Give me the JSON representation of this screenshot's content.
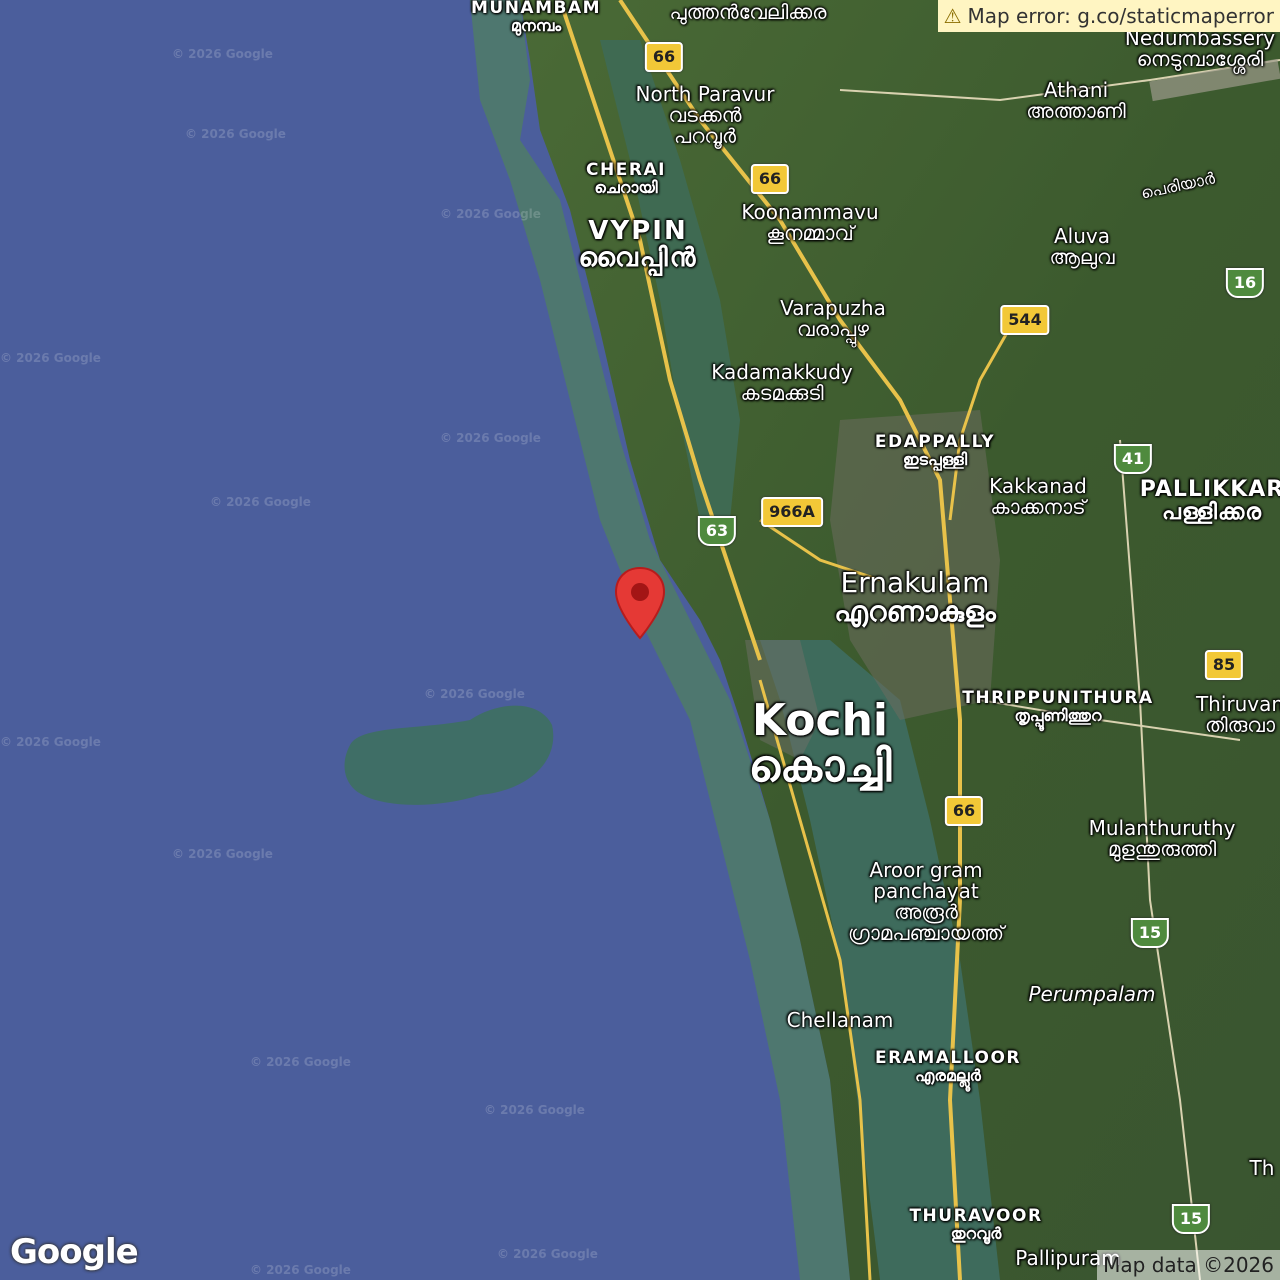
{
  "map": {
    "colors": {
      "sea": "#4b5e9c",
      "land": "#3e5a2e",
      "coastal": "#4f7a6a",
      "road": "#e8c24a"
    },
    "labels": {
      "munambam": {
        "en": "MUNAMBAM",
        "ml": "മുനമ്പം"
      },
      "puthenvelikkara": {
        "ml": "പുത്തൻവേലിക്കര"
      },
      "nedumbassery": {
        "en": "Nedumbassery",
        "ml": "നെടുമ്പാശ്ശേരി"
      },
      "north_paravur": {
        "en": "North Paravur",
        "ml1": "വടക്കൻ",
        "ml2": "പറവൂർ"
      },
      "athani": {
        "en": "Athani",
        "ml": "അത്താണി"
      },
      "cherai": {
        "en": "CHERAI",
        "ml": "ചെറായി"
      },
      "periyar": {
        "ml": "പെരിയാർ"
      },
      "vypin": {
        "en": "VYPIN",
        "ml": "വൈപ്പിൻ"
      },
      "koonammavu": {
        "en": "Koonammavu",
        "ml": "കൂനമ്മാവ്"
      },
      "aluva": {
        "en": "Aluva",
        "ml": "ആലുവ"
      },
      "varapuzha": {
        "en": "Varapuzha",
        "ml": "വരാപ്പുഴ"
      },
      "kadamakkudy": {
        "en": "Kadamakkudy",
        "ml": "കടമക്കുടി"
      },
      "edappally": {
        "en": "EDAPPALLY",
        "ml": "ഇടപ്പള്ളി"
      },
      "kakkanad": {
        "en": "Kakkanad",
        "ml": "കാക്കനാട്"
      },
      "pallikkara": {
        "en": "PALLIKKAR",
        "ml": "പള്ളിക്കര"
      },
      "ernakulam": {
        "en": "Ernakulam",
        "ml": "എറണാകുളം"
      },
      "thrippunithura": {
        "en": "THRIPPUNITHURA",
        "ml": "തൃപ്പൂണിത്തുറ"
      },
      "thiruvankulam": {
        "en": "Thiruvan",
        "ml": "തിരുവാ"
      },
      "kochi": {
        "en": "Kochi",
        "ml": "കൊച്ചി"
      },
      "mulanthuruthy": {
        "en": "Mulanthuruthy",
        "ml": "മുളന്തുരുത്തി"
      },
      "aroor": {
        "en1": "Aroor gram",
        "en2": "panchayat",
        "ml1": "അരൂർ",
        "ml2": "ഗ്രാമപഞ്ചായത്ത്"
      },
      "perumpalam": {
        "en": "Perumpalam"
      },
      "chellanam": {
        "en": "Chellanam"
      },
      "eramalloor": {
        "en": "ERAMALLOOR",
        "ml": "എരമല്ലൂർ"
      },
      "thuravoor": {
        "en": "THURAVOOR",
        "ml": "തുറവൂർ"
      },
      "pallipuram": {
        "en": "Pallipuram"
      },
      "edge_th": {
        "en": "Th"
      }
    },
    "shields": {
      "nh66_a": "66",
      "nh66_b": "66",
      "nh66_c": "66",
      "sh16": "16",
      "nh544": "544",
      "sh41": "41",
      "nh966a": "966A",
      "sh63": "63",
      "nh85": "85",
      "sh15_a": "15",
      "sh15_b": "15"
    },
    "watermark": "© 2026 Google"
  },
  "overlay": {
    "error_text": "Map error: g.co/staticmaperror",
    "attribution": "Map data ©2026",
    "logo": "Google",
    "marker_icon": "map-pin-icon",
    "warning_icon": "warning-icon"
  }
}
